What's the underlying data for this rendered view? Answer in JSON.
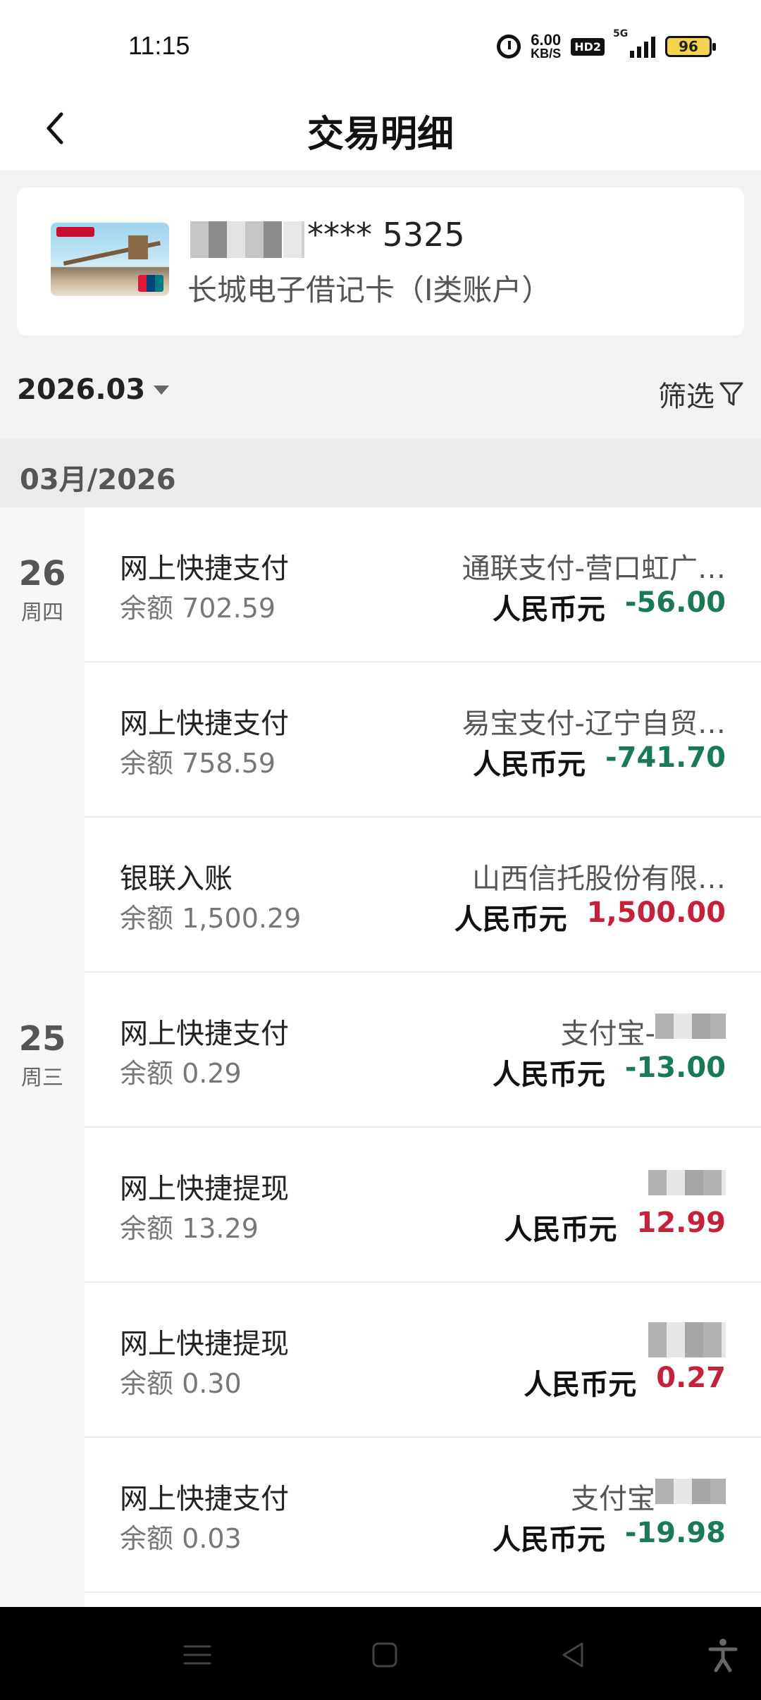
{
  "status_bar": {
    "time": "11:15",
    "net_speed": "6.00",
    "net_unit": "KB/S",
    "hd": "HD2",
    "signal": "5G",
    "battery": "96"
  },
  "header": {
    "title": "交易明细"
  },
  "card": {
    "number_suffix": "**** 5325",
    "name": "长城电子借记卡（I类账户）"
  },
  "filter_bar": {
    "month": "2026.03",
    "filter_label": "筛选"
  },
  "section": {
    "label": "03月/2026"
  },
  "dates": [
    {
      "day": "26",
      "weekday": "周四"
    },
    {
      "day": "25",
      "weekday": "周三"
    }
  ],
  "transactions": [
    {
      "type": "网上快捷支付",
      "balance": "余额  702.59",
      "counterparty": "通联支付-营口虹广…",
      "currency": "人民币元",
      "amount": "-56.00",
      "sign": "neg"
    },
    {
      "type": "网上快捷支付",
      "balance": "余额  758.59",
      "counterparty": "易宝支付-辽宁自贸…",
      "currency": "人民币元",
      "amount": "-741.70",
      "sign": "neg"
    },
    {
      "type": "银联入账",
      "balance": "余额  1,500.29",
      "counterparty": "山西信托股份有限…",
      "currency": "人民币元",
      "amount": "1,500.00",
      "sign": "pos"
    },
    {
      "type": "网上快捷支付",
      "balance": "余额  0.29",
      "counterparty": "支付宝-",
      "currency": "人民币元",
      "amount": "-13.00",
      "sign": "neg"
    },
    {
      "type": "网上快捷提现",
      "balance": "余额  13.29",
      "counterparty": "",
      "currency": "人民币元",
      "amount": "12.99",
      "sign": "pos"
    },
    {
      "type": "网上快捷提现",
      "balance": "余额  0.30",
      "counterparty": "",
      "currency": "人民币元",
      "amount": "0.27",
      "sign": "pos"
    },
    {
      "type": "网上快捷支付",
      "balance": "余额  0.03",
      "counterparty": "支付宝",
      "currency": "人民币元",
      "amount": "-19.98",
      "sign": "neg"
    }
  ],
  "colors": {
    "negative": "#1a7a55",
    "positive": "#c5213a"
  }
}
